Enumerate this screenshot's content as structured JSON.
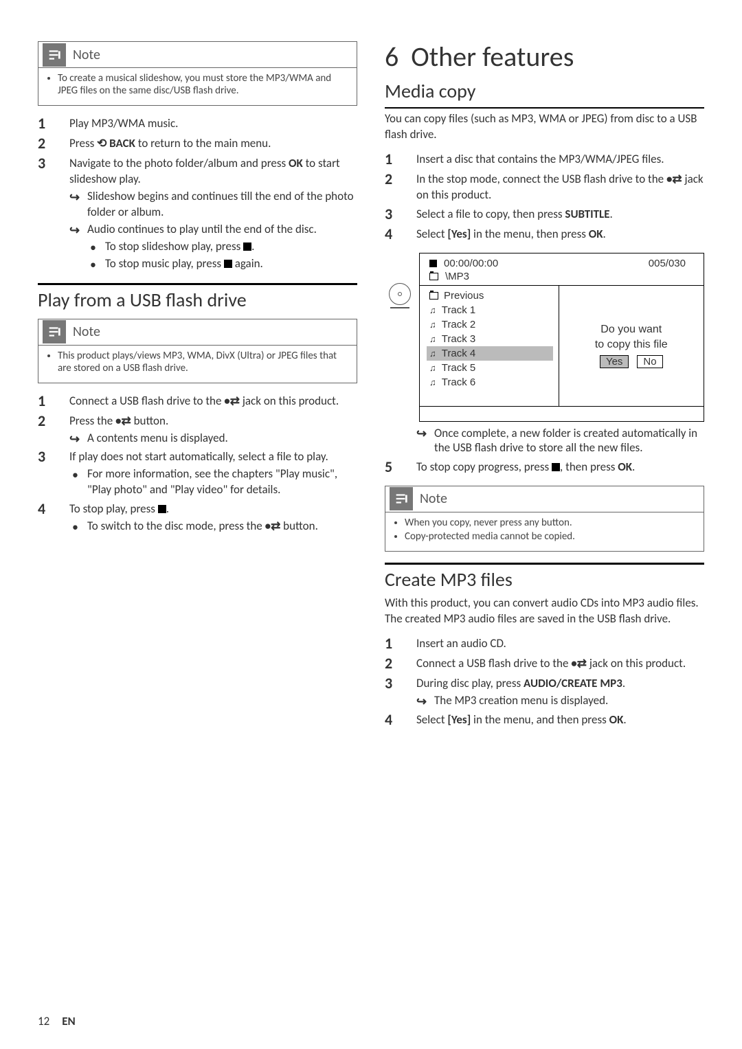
{
  "left": {
    "note1": {
      "label": "Note",
      "items": [
        "To create a musical slideshow, you must store the MP3/WMA and JPEG files on the same disc/USB flash drive."
      ]
    },
    "slideshow": {
      "s1": "Play MP3/WMA music.",
      "s2a": "Press ",
      "s2b": " BACK",
      "s2c": " to return to the main menu.",
      "s3a": "Navigate to the photo folder/album and press ",
      "s3b": "OK",
      "s3c": " to start slideshow play.",
      "s3_sub1": "Slideshow begins and continues till the end of the photo folder or album.",
      "s3_sub2": "Audio continues to play until the end of the disc.",
      "s3_sub3a": "To stop slideshow play, press ",
      "s3_sub3b": ".",
      "s3_sub4a": "To stop music play, press ",
      "s3_sub4b": " again."
    },
    "usb_heading": "Play from a USB flash drive",
    "note2": {
      "label": "Note",
      "items": [
        "This product plays/views MP3, WMA, DivX (Ultra) or JPEG files that are stored on a USB flash drive."
      ]
    },
    "usb": {
      "s1a": "Connect a USB flash drive to the ",
      "s1b": " jack on this product.",
      "s2a": "Press the ",
      "s2b": " button.",
      "s2_sub1": "A contents menu is displayed.",
      "s3": "If play does not start automatically, select a file to play.",
      "s3_sub1": "For more information, see the chapters \"Play music\", \"Play photo\" and \"Play video\" for details.",
      "s4a": "To stop play, press ",
      "s4b": ".",
      "s4_sub1a": "To switch to the disc mode, press the ",
      "s4_sub1b": " button."
    }
  },
  "right": {
    "chapter_num": "6",
    "chapter_title": "Other features",
    "media_copy_heading": "Media copy",
    "media_copy_intro": "You can copy files (such as MP3, WMA or JPEG) from disc to a USB flash drive.",
    "mc": {
      "s1": "Insert a disc that contains the MP3/WMA/JPEG files.",
      "s2a": "In the stop mode, connect the USB flash drive to the ",
      "s2b": " jack on this product.",
      "s3a": "Select a file to copy, then press ",
      "s3b": "SUBTITLE",
      "s3c": ".",
      "s4a": "Select ",
      "s4b": "[Yes]",
      "s4c": " in the menu, then press ",
      "s4d": "OK",
      "s4e": ".",
      "s4_sub1": "Once complete, a new folder is created automatically in the USB flash drive to store all the new files.",
      "s5a": "To stop copy progress, press ",
      "s5b": ", then press ",
      "s5c": "OK",
      "s5d": "."
    },
    "screen": {
      "time": "00:00/00:00",
      "count": "005/030",
      "path": "\\MP3",
      "previous": "Previous",
      "tracks": [
        "Track 1",
        "Track 2",
        "Track 3",
        "Track 4",
        "Track 5",
        "Track 6"
      ],
      "selected_index": 3,
      "prompt1": "Do you want",
      "prompt2": "to copy this file",
      "yes": "Yes",
      "no": "No"
    },
    "note3": {
      "label": "Note",
      "items": [
        "When you copy, never press any button.",
        "Copy-protected media cannot be copied."
      ]
    },
    "create_heading": "Create MP3 files",
    "create_intro": "With this product, you can convert audio CDs into MP3 audio files. The created MP3 audio files are saved in the USB flash drive.",
    "cr": {
      "s1": "Insert an audio CD.",
      "s2a": "Connect a USB flash drive to the ",
      "s2b": " jack on this product.",
      "s3a": "During disc play, press ",
      "s3b": "AUDIO/CREATE MP3",
      "s3c": ".",
      "s3_sub1": "The MP3 creation menu is displayed.",
      "s4a": "Select ",
      "s4b": "[Yes]",
      "s4c": " in the menu, and then press ",
      "s4d": "OK",
      "s4e": "."
    }
  },
  "footer": {
    "page": "12",
    "lang": "EN"
  }
}
